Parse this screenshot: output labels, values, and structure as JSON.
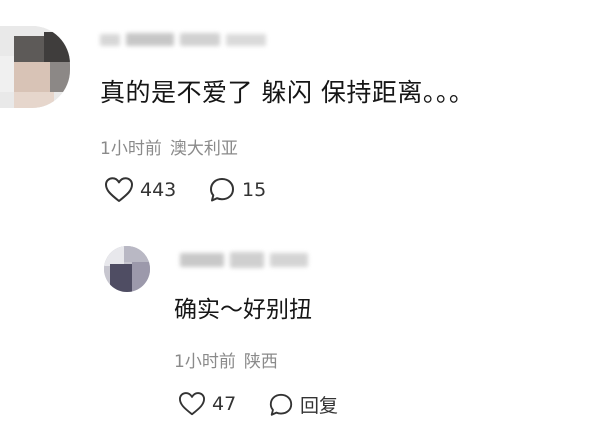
{
  "comment": {
    "text": "真的是不爱了 躲闪 保持距离。。。",
    "time": "1小时前",
    "location": "澳大利亚",
    "likes": "443",
    "replies": "15"
  },
  "reply": {
    "text": "确实～好别扭",
    "time": "1小时前",
    "location": "陕西",
    "likes": "47",
    "reply_label": "回复"
  },
  "icons": {
    "like": "heart-icon",
    "comment": "comment-bubble-icon"
  },
  "colors": {
    "text": "#161616",
    "meta": "#8a8a8a",
    "icon": "#333333"
  }
}
